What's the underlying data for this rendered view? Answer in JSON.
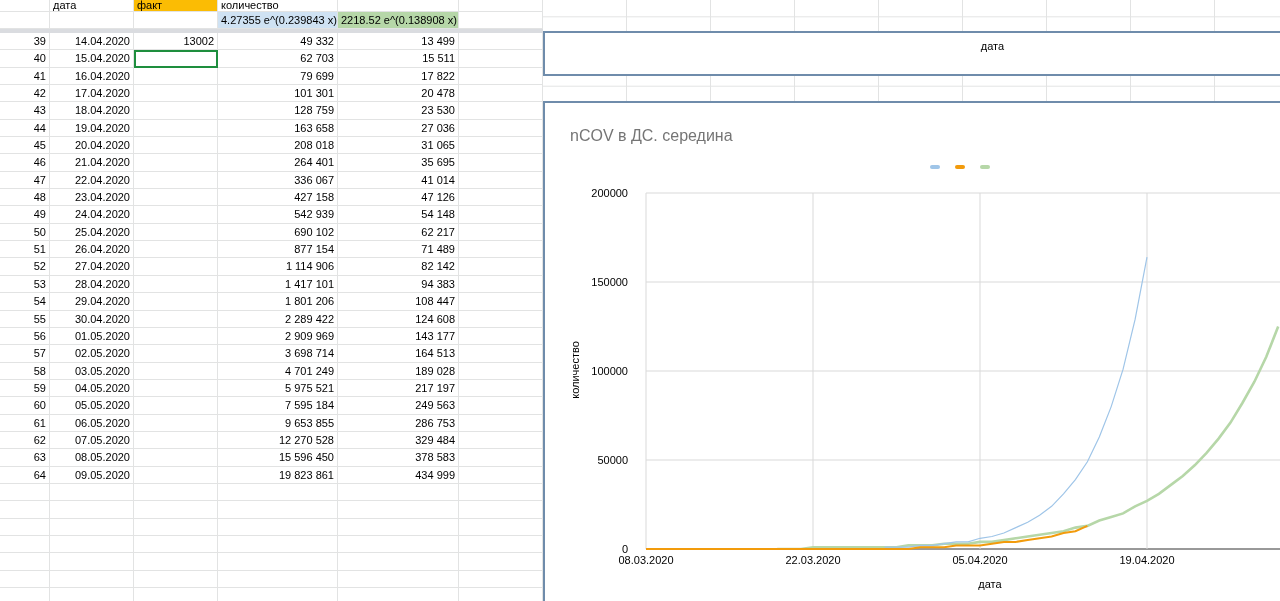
{
  "sheet": {
    "header_row": [
      {
        "text": "дата"
      },
      {
        "text": "факт",
        "color": "#fbbc04"
      },
      {
        "text": "количество"
      }
    ],
    "formula_row": [
      {
        "text": "4.27355 e^(0.239843 x)",
        "color": "#cfe2f3"
      },
      {
        "text": "2218.52 e^(0.138908 x)",
        "color": "#b6d7a8"
      }
    ],
    "rows": [
      {
        "n": "39",
        "date": "14.04.2020",
        "fact": "13002",
        "forecast_1": "49 332",
        "forecast_2": "13 499",
        "selected": false
      },
      {
        "n": "40",
        "date": "15.04.2020",
        "forecast_1": "62 703",
        "forecast_2": "15 511",
        "selected": true
      },
      {
        "n": "41",
        "date": "16.04.2020",
        "forecast_1": "79 699",
        "forecast_2": "17 822",
        "selected": false
      },
      {
        "n": "42",
        "date": "17.04.2020",
        "forecast_1": "101 301",
        "forecast_2": "20 478",
        "selected": false
      },
      {
        "n": "43",
        "date": "18.04.2020",
        "forecast_1": "128 759",
        "forecast_2": "23 530",
        "selected": false
      },
      {
        "n": "44",
        "date": "19.04.2020",
        "forecast_1": "163 658",
        "forecast_2": "27 036",
        "selected": false
      },
      {
        "n": "45",
        "date": "20.04.2020",
        "forecast_1": "208 018",
        "forecast_2": "31 065",
        "selected": false
      },
      {
        "n": "46",
        "date": "21.04.2020",
        "forecast_1": "264 401",
        "forecast_2": "35 695",
        "selected": false
      },
      {
        "n": "47",
        "date": "22.04.2020",
        "forecast_1": "336 067",
        "forecast_2": "41 014",
        "selected": false
      },
      {
        "n": "48",
        "date": "23.04.2020",
        "forecast_1": "427 158",
        "forecast_2": "47 126",
        "selected": false
      },
      {
        "n": "49",
        "date": "24.04.2020",
        "forecast_1": "542 939",
        "forecast_2": "54 148",
        "selected": false
      },
      {
        "n": "50",
        "date": "25.04.2020",
        "forecast_1": "690 102",
        "forecast_2": "62 217",
        "selected": false
      },
      {
        "n": "51",
        "date": "26.04.2020",
        "forecast_1": "877 154",
        "forecast_2": "71 489",
        "selected": false
      },
      {
        "n": "52",
        "date": "27.04.2020",
        "forecast_1": "1 114 906",
        "forecast_2": "82 142",
        "selected": false
      },
      {
        "n": "53",
        "date": "28.04.2020",
        "forecast_1": "1 417 101",
        "forecast_2": "94 383",
        "selected": false
      },
      {
        "n": "54",
        "date": "29.04.2020",
        "forecast_1": "1 801 206",
        "forecast_2": "108 447",
        "selected": false
      },
      {
        "n": "55",
        "date": "30.04.2020",
        "forecast_1": "2 289 422",
        "forecast_2": "124 608",
        "selected": false
      },
      {
        "n": "56",
        "date": "01.05.2020",
        "forecast_1": "2 909 969",
        "forecast_2": "143 177",
        "selected": false
      },
      {
        "n": "57",
        "date": "02.05.2020",
        "forecast_1": "3 698 714",
        "forecast_2": "164 513",
        "selected": false
      },
      {
        "n": "58",
        "date": "03.05.2020",
        "forecast_1": "4 701 249",
        "forecast_2": "189 028",
        "selected": false
      },
      {
        "n": "59",
        "date": "04.05.2020",
        "forecast_1": "5 975 521",
        "forecast_2": "217 197",
        "selected": false
      },
      {
        "n": "60",
        "date": "05.05.2020",
        "forecast_1": "7 595 184",
        "forecast_2": "249 563",
        "selected": false
      },
      {
        "n": "61",
        "date": "06.05.2020",
        "forecast_1": "9 653 855",
        "forecast_2": "286 753",
        "selected": false
      },
      {
        "n": "62",
        "date": "07.05.2020",
        "forecast_1": "12 270 528",
        "forecast_2": "329 484",
        "selected": false
      },
      {
        "n": "63",
        "date": "08.05.2020",
        "forecast_1": "15 596 450",
        "forecast_2": "378 583",
        "selected": false
      },
      {
        "n": "64",
        "date": "09.05.2020",
        "forecast_1": "19 823 861",
        "forecast_2": "434 999",
        "selected": false
      }
    ]
  },
  "top_chart": {
    "xlabel": "дата"
  },
  "chart": {
    "chart_data": {
      "type": "line",
      "title": "nCOV в ДС. середина",
      "xlabel": "дата",
      "ylabel": "количество",
      "categories": [
        "08.03.2020",
        null,
        null,
        null,
        null,
        null,
        null,
        null,
        null,
        null,
        null,
        null,
        null,
        null,
        "22.03.2020",
        null,
        null,
        null,
        null,
        null,
        null,
        null,
        null,
        null,
        null,
        null,
        null,
        null,
        "05.04.2020",
        null,
        null,
        null,
        null,
        null,
        null,
        null,
        null,
        null,
        null,
        null,
        null,
        null,
        "19.04.2020",
        null,
        null,
        null,
        null,
        null,
        null,
        null,
        null,
        null,
        null,
        null
      ],
      "grid": true,
      "series": [
        {
          "color": "#9fc5e8",
          "values": [
            null,
            null,
            null,
            null,
            null,
            null,
            null,
            null,
            null,
            null,
            null,
            null,
            null,
            null,
            null,
            null,
            null,
            null,
            null,
            null,
            1000,
            1000,
            1000,
            2000,
            2000,
            3000,
            4000,
            4000,
            6000,
            7000,
            9000,
            12000,
            15000,
            19000,
            24000,
            31000,
            39000,
            49000,
            63000,
            80000,
            101000,
            129000,
            164000,
            null,
            null,
            null,
            null,
            null,
            null,
            null,
            null,
            null,
            null,
            null
          ]
        },
        {
          "color": "#f29b0c",
          "values": [
            0,
            0,
            0,
            0,
            0,
            0,
            0,
            0,
            0,
            0,
            0,
            0,
            0,
            0,
            0,
            0,
            0,
            0,
            0,
            0,
            0,
            0,
            0,
            1000,
            1000,
            1000,
            2000,
            2000,
            2000,
            3000,
            4000,
            4000,
            5000,
            6000,
            7000,
            9000,
            10000,
            13000,
            null,
            null,
            null,
            null,
            null,
            null,
            null,
            null,
            null,
            null,
            null,
            null,
            null,
            null,
            null,
            null
          ]
        },
        {
          "color": "#b6d7a8",
          "values": [
            null,
            null,
            null,
            null,
            null,
            null,
            null,
            null,
            null,
            null,
            null,
            0,
            0,
            0,
            1000,
            1000,
            1000,
            1000,
            1000,
            1000,
            1000,
            1000,
            2000,
            2000,
            2000,
            3000,
            3000,
            3000,
            4000,
            4000,
            5000,
            6000,
            7000,
            8000,
            9000,
            10000,
            12000,
            13000,
            16000,
            18000,
            20000,
            24000,
            27000,
            31000,
            36000,
            41000,
            47000,
            54000,
            62000,
            71000,
            82000,
            94000,
            108000,
            125000
          ]
        }
      ],
      "ylim": [
        0,
        200000
      ],
      "yticks": [
        0,
        50000,
        100000,
        150000,
        200000
      ]
    }
  }
}
